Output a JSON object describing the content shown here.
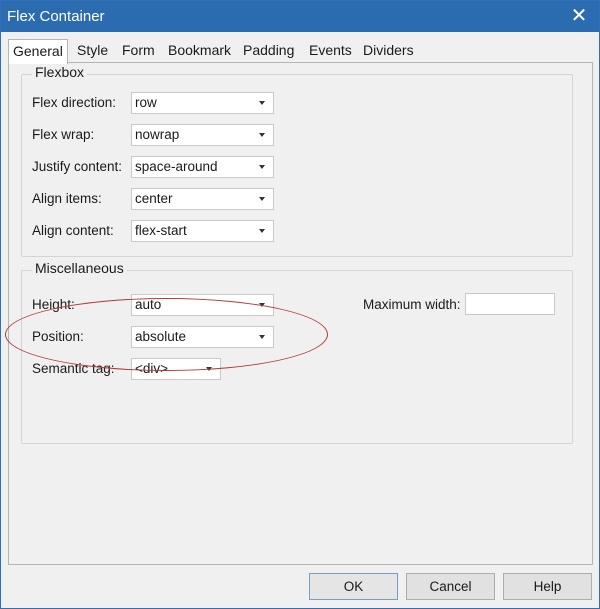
{
  "window": {
    "title": "Flex Container",
    "close_glyph": "✕"
  },
  "tabs": [
    {
      "label": "General",
      "active": true
    },
    {
      "label": "Style"
    },
    {
      "label": "Form"
    },
    {
      "label": "Bookmark"
    },
    {
      "label": "Padding"
    },
    {
      "label": "Events"
    },
    {
      "label": "Dividers"
    }
  ],
  "flexbox": {
    "title": "Flexbox",
    "direction": {
      "label": "Flex direction:",
      "value": "row"
    },
    "wrap": {
      "label": "Flex wrap:",
      "value": "nowrap"
    },
    "justify": {
      "label": "Justify content:",
      "value": "space-around"
    },
    "align_items": {
      "label": "Align items:",
      "value": "center"
    },
    "align_content": {
      "label": "Align content:",
      "value": "flex-start"
    }
  },
  "misc": {
    "title": "Miscellaneous",
    "height": {
      "label": "Height:",
      "value": "auto"
    },
    "position": {
      "label": "Position:",
      "value": "absolute"
    },
    "semantic_tag": {
      "label": "Semantic tag:",
      "value": "<div>"
    },
    "max_width": {
      "label": "Maximum width:",
      "value": ""
    }
  },
  "buttons": {
    "ok": "OK",
    "cancel": "Cancel",
    "help": "Help"
  },
  "colors": {
    "titlebar": "#2b6cb0",
    "annotation": "#b33a3a",
    "panel": "#f0f0f0"
  }
}
